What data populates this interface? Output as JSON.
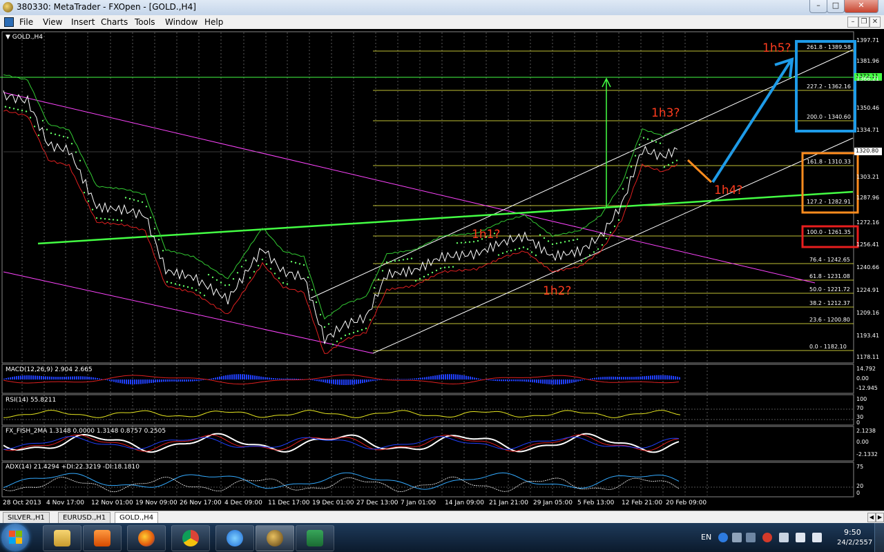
{
  "window": {
    "title": "380330: MetaTrader - FXOpen - [GOLD.,H4]",
    "controls": {
      "minimize": "–",
      "maximize": "□",
      "close": "✕"
    }
  },
  "menu": {
    "items": [
      "File",
      "View",
      "Insert",
      "Charts",
      "Tools",
      "Window",
      "Help"
    ],
    "mdi_controls": {
      "minimize": "–",
      "restore": "❐",
      "close": "✕"
    }
  },
  "chart": {
    "symbol_label": "GOLD.,H4",
    "current_price": "1320.80",
    "level_price": "1372.11",
    "price_axis": [
      "1397.71",
      "1381.96",
      "1366.21",
      "1350.46",
      "1334.71",
      "1303.21",
      "1287.96",
      "1272.16",
      "1256.41",
      "1240.66",
      "1224.91",
      "1209.16",
      "1193.41",
      "1178.11"
    ],
    "fib_levels": [
      {
        "label": "261.8 - 1389.58"
      },
      {
        "label": "227.2 - 1362.16"
      },
      {
        "label": "200.0 - 1340.60"
      },
      {
        "label": "161.8 - 1310.33"
      },
      {
        "label": "127.2 - 1282.91"
      },
      {
        "label": "100.0 - 1261.35"
      },
      {
        "label": "76.4 - 1242.65"
      },
      {
        "label": "61.8 - 1231.08"
      },
      {
        "label": "50.0 - 1221.72"
      },
      {
        "label": "38.2 - 1212.37"
      },
      {
        "label": "23.6 - 1200.80"
      },
      {
        "label": "0.0 - 1182.10"
      }
    ],
    "annotations": [
      "1h1?",
      "1h2?",
      "1h3?",
      "1h4?",
      "1h5?"
    ],
    "date_axis": [
      "28 Oct 2013",
      "4 Nov 17:00",
      "12 Nov 01:00",
      "19 Nov 09:00",
      "26 Nov 17:00",
      "4 Dec 09:00",
      "11 Dec 17:00",
      "19 Dec 01:00",
      "27 Dec 13:00",
      "7 Jan 01:00",
      "14 Jan 09:00",
      "21 Jan 21:00",
      "29 Jan 05:00",
      "5 Feb 13:00",
      "12 Feb 21:00",
      "20 Feb 09:00"
    ]
  },
  "indicators": {
    "macd": {
      "label": "MACD(12,26,9) 2.904 2.665",
      "axis": [
        "14.792",
        "0.00",
        "-12.945"
      ]
    },
    "rsi": {
      "label": "RSI(14) 55.8211",
      "axis": [
        "100",
        "70",
        "30",
        "0"
      ]
    },
    "fish": {
      "label": "FX_FISH_2MA 1.3148 0.0000 1.3148 0.8757 0.2505",
      "axis": [
        "2.1238",
        "0.00",
        "-2.1332"
      ]
    },
    "adx": {
      "label": "ADX(14) 21.4294 +DI:22.3219 -DI:18.1810",
      "axis": [
        "75",
        "20",
        "0"
      ]
    }
  },
  "tabs": [
    {
      "label": "SILVER.,H1"
    },
    {
      "label": "EURUSD.,H1"
    },
    {
      "label": "GOLD.,H4",
      "active": true
    }
  ],
  "taskbar": {
    "apps": [
      "explorer-icon",
      "media-player-icon",
      "firefox-icon",
      "chrome-icon",
      "ie-icon",
      "metatrader-icon",
      "excel-icon"
    ],
    "language": "EN",
    "time": "9:50",
    "date": "24/2/2557"
  },
  "colors": {
    "green_line": "#44ff44",
    "magenta_line": "#ff44ff",
    "fib_yellow": "#ffff44",
    "annotation_orange": "#ff3c1e",
    "box_blue": "#1e9be8",
    "box_orange": "#ff8c1e",
    "box_red": "#e81e1e"
  }
}
